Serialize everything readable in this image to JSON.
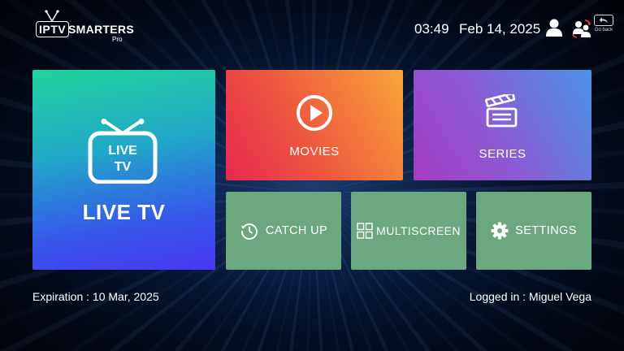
{
  "header": {
    "logo": {
      "iptv": "IPTV",
      "smarters": "SMARTERS",
      "pro": "Pro"
    },
    "time": "03:49",
    "date": "Feb 14, 2025",
    "go_back_label": "Go back"
  },
  "tiles": {
    "live_tv": {
      "icon_text_line1": "LIVE",
      "icon_text_line2": "TV",
      "label": "LIVE TV"
    },
    "movies": {
      "label": "MOVIES"
    },
    "series": {
      "label": "SERIES"
    },
    "catch_up": {
      "label": "CATCH UP"
    },
    "multiscreen": {
      "label": "MULTISCREEN"
    },
    "settings": {
      "label": "SETTINGS"
    }
  },
  "footer": {
    "expiration": "Expiration : 10 Mar, 2025",
    "logged_in": "Logged in : Miguel Vega"
  },
  "colors": {
    "live_tv_gradient": [
      "#1fd49a",
      "#3557ea",
      "#4a37f2"
    ],
    "movies_gradient": [
      "#e8284f",
      "#f9a63a"
    ],
    "series_gradient": [
      "#a63cc4",
      "#4a93e6"
    ],
    "small_tile": "#6ba77f",
    "background": "#061632"
  },
  "icons": {
    "live_tv": "tv-antenna-icon",
    "movies": "play-circle-icon",
    "series": "clapperboard-icon",
    "catch_up": "history-clock-icon",
    "multiscreen": "grid-icon",
    "settings": "gear-icon",
    "user": "user-icon",
    "switch_user": "switch-user-icon",
    "go_back": "back-arrow-icon"
  }
}
